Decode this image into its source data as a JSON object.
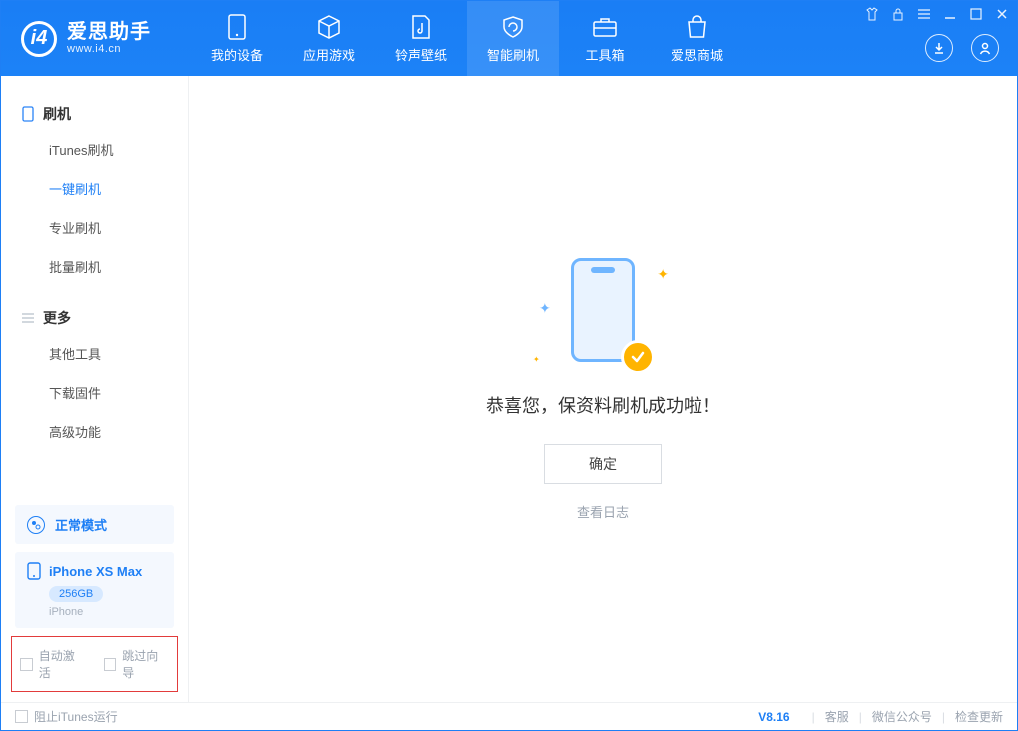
{
  "app": {
    "title": "爱思助手",
    "subtitle": "www.i4.cn"
  },
  "nav": {
    "my_device": "我的设备",
    "app_games": "应用游戏",
    "ring_wall": "铃声壁纸",
    "smart_flash": "智能刷机",
    "toolbox": "工具箱",
    "store": "爱思商城"
  },
  "sidebar": {
    "flash_group": "刷机",
    "items": {
      "itunes": "iTunes刷机",
      "oneclick": "一键刷机",
      "pro": "专业刷机",
      "batch": "批量刷机"
    },
    "more_group": "更多",
    "more": {
      "other": "其他工具",
      "download": "下载固件",
      "advanced": "高级功能"
    }
  },
  "mode": {
    "label": "正常模式"
  },
  "device": {
    "name": "iPhone XS Max",
    "storage": "256GB",
    "type": "iPhone"
  },
  "checks": {
    "auto_activate": "自动激活",
    "skip_guide": "跳过向导"
  },
  "main": {
    "success": "恭喜您，保资料刷机成功啦！",
    "ok": "确定",
    "view_log": "查看日志"
  },
  "status": {
    "block_itunes": "阻止iTunes运行",
    "version": "V8.16",
    "support": "客服",
    "wechat": "微信公众号",
    "check_update": "检查更新"
  }
}
